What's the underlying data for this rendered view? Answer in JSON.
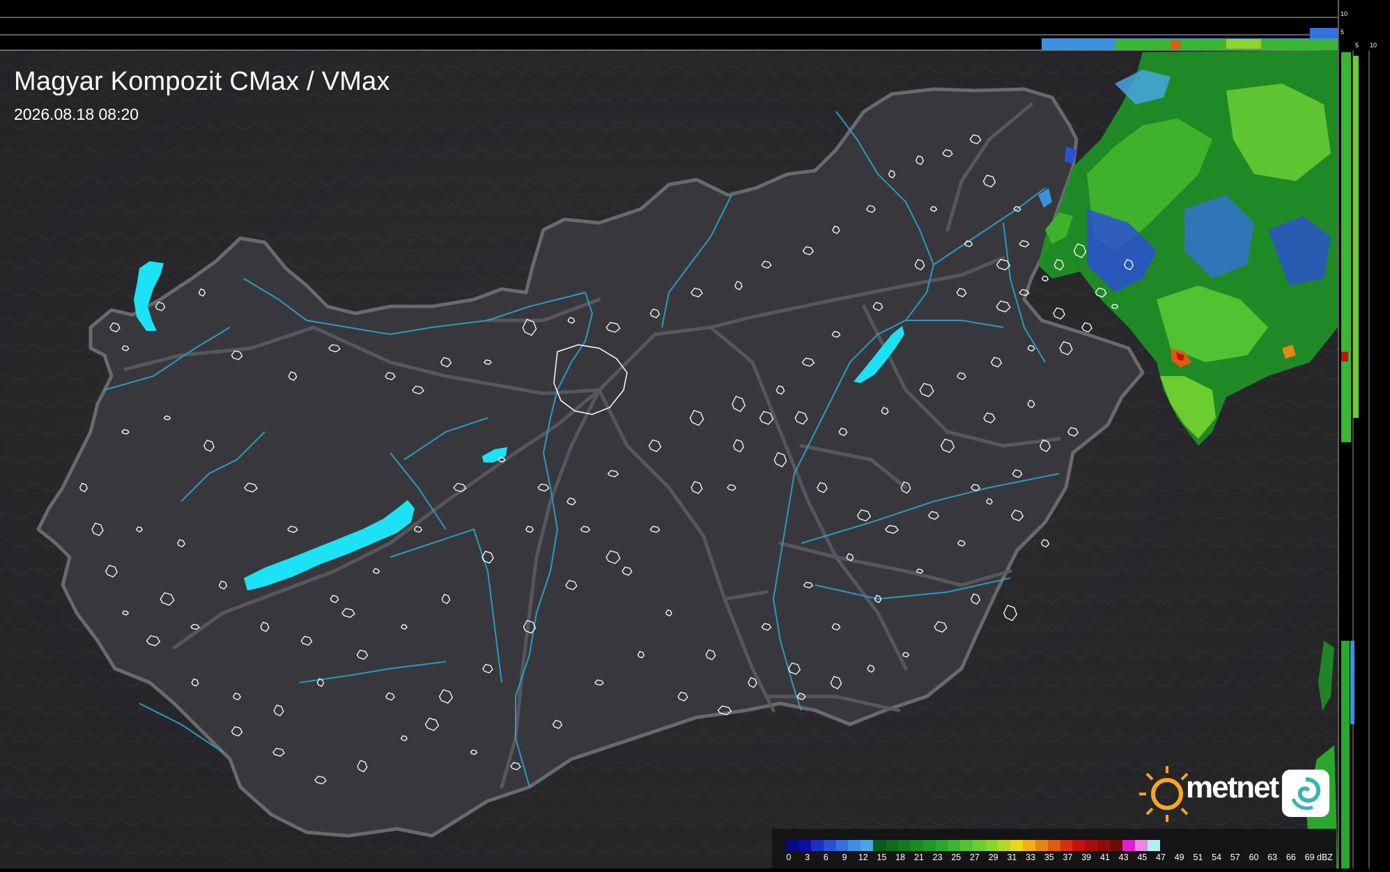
{
  "title": "Magyar Kompozit CMax / VMax",
  "timestamp": "2026.08.18 08:20",
  "side_scale_ticks": [
    "10",
    "5",
    "5",
    "10"
  ],
  "logo": {
    "text": "metnet",
    "icon": "sun-icon",
    "badge_icon": "swirl-icon"
  },
  "legend": {
    "unit": "dBZ",
    "labels": [
      "0",
      "3",
      "6",
      "9",
      "12",
      "15",
      "18",
      "21",
      "23",
      "25",
      "27",
      "29",
      "31",
      "33",
      "35",
      "37",
      "39",
      "41",
      "43",
      "45",
      "47",
      "49",
      "51",
      "54",
      "57",
      "60",
      "63",
      "66",
      "69"
    ],
    "colors": [
      "#0a0a80",
      "#0d0ea8",
      "#1c2fc6",
      "#2a50d5",
      "#3570dc",
      "#3f8fe0",
      "#46a6e0",
      "#0a5a1a",
      "#0e6a1e",
      "#137a22",
      "#198b26",
      "#20992a",
      "#2aa82e",
      "#3ab632",
      "#52c233",
      "#6ccd30",
      "#8cd42a",
      "#b5d820",
      "#e6d81a",
      "#f0b018",
      "#e88515",
      "#e05a12",
      "#d6300e",
      "#c81010",
      "#a80e0e",
      "#900c0c",
      "#700a0a",
      "#e020d0",
      "#e888e0",
      "#b0f0f0"
    ]
  },
  "map_colors": {
    "background": "#2b2b2e",
    "country": "#38383c",
    "border": "#6a6a6e",
    "road": "#5a5a60",
    "river": "#2aa0c8",
    "lake": "#1ce2f5",
    "city": "#ffffff"
  }
}
